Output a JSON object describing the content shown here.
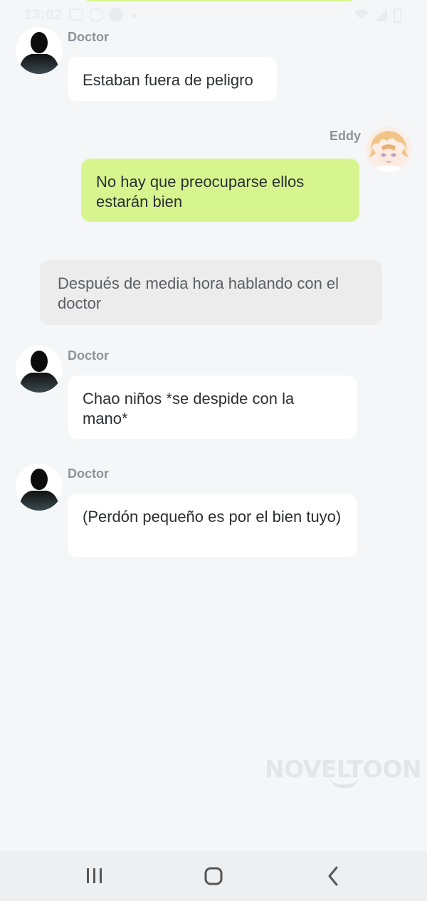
{
  "status_bar": {
    "time": "13:02",
    "icons": [
      "gallery-icon",
      "whatsapp-icon",
      "messenger-icon",
      "notification-dot-icon",
      "wifi-icon",
      "signal-icon",
      "battery-icon"
    ]
  },
  "messages": [
    {
      "type": "incoming",
      "speaker": "Doctor",
      "avatar": "doctor-silhouette-avatar",
      "text": "Estaban fuera de peligro"
    },
    {
      "type": "outgoing",
      "speaker": "Eddy",
      "avatar": "eddy-anime-avatar",
      "text": "No hay que preocuparse ellos estarán bien"
    },
    {
      "type": "narration",
      "text": "Después de media hora hablando con el doctor"
    },
    {
      "type": "incoming",
      "speaker": "Doctor",
      "avatar": "doctor-silhouette-avatar",
      "text": "Chao niños *se despide con la mano*"
    },
    {
      "type": "incoming",
      "speaker": "Doctor",
      "avatar": "doctor-silhouette-avatar",
      "text": "(Perdón pequeño es por el bien tuyo)"
    }
  ],
  "watermark": {
    "text": "NOVELTOON"
  },
  "nav_bar": {
    "icons": [
      "recents-icon",
      "home-icon",
      "back-icon"
    ]
  },
  "colors": {
    "background": "#f4f6f8",
    "incoming_bubble": "#ffffff",
    "outgoing_bubble": "#d7f58f",
    "narration_bubble": "#ececec",
    "name_text": "#8d9399",
    "nav_bar": "#eeeff1"
  }
}
